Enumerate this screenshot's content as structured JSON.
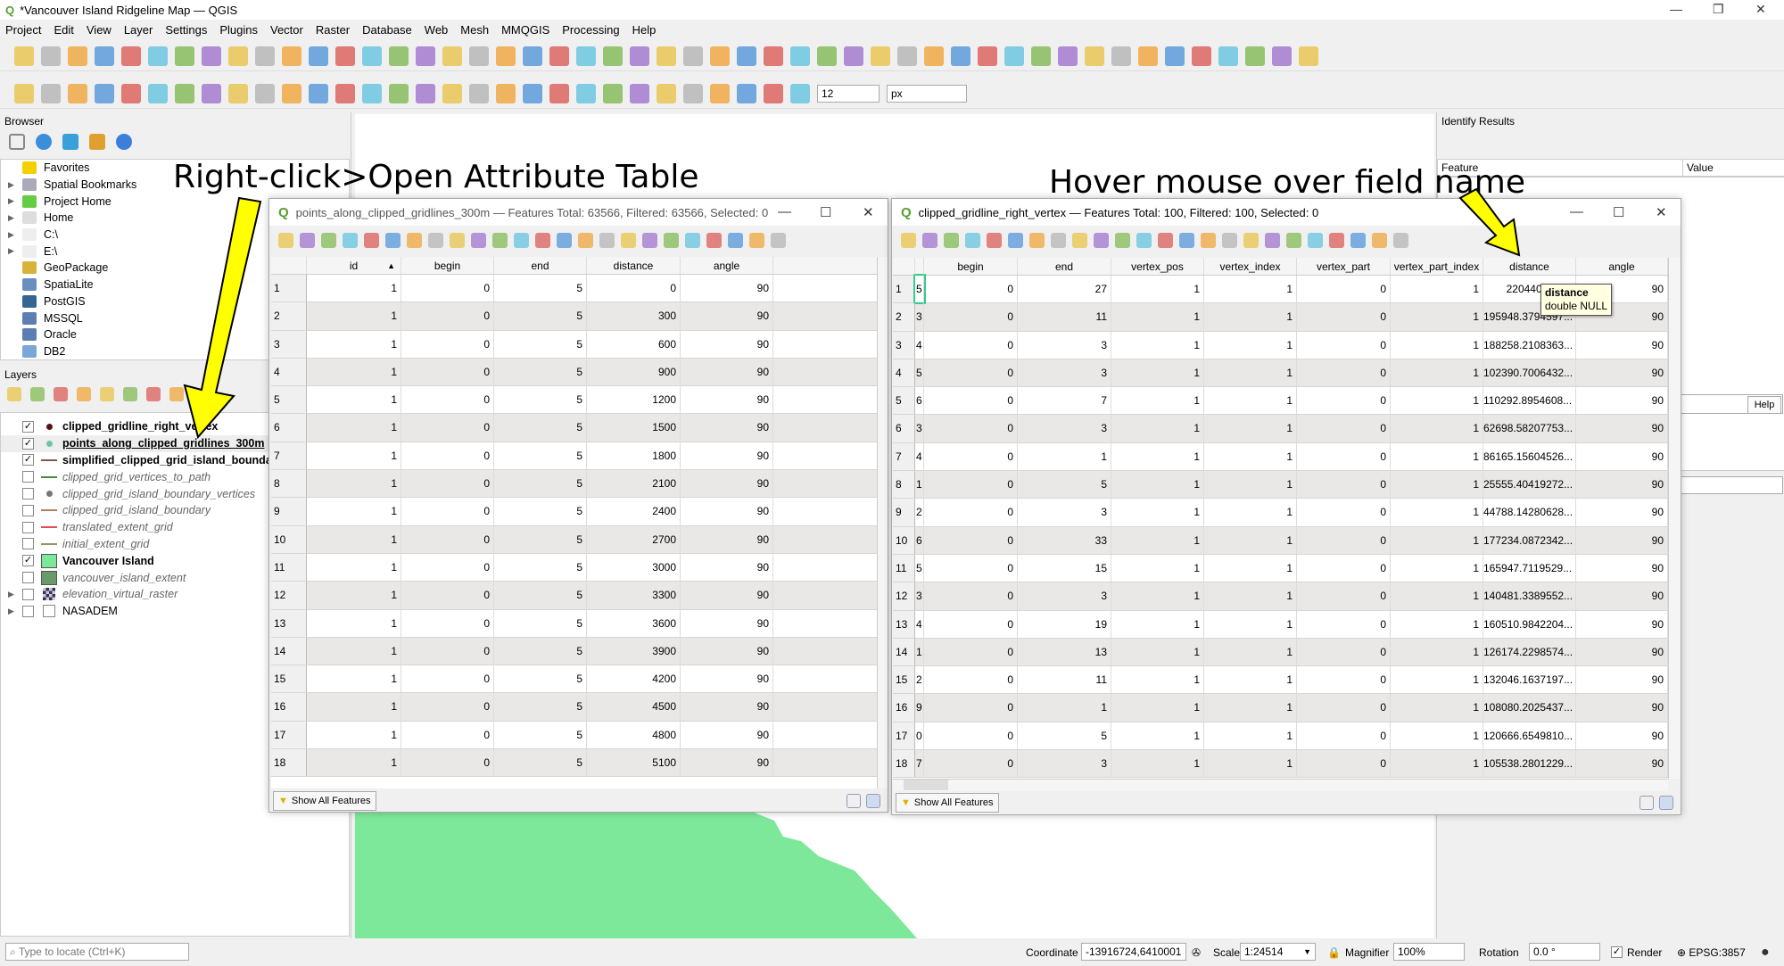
{
  "app": {
    "title": "*Vancouver Island Ridgeline Map — QGIS"
  },
  "menu": [
    "Project",
    "Edit",
    "View",
    "Layer",
    "Settings",
    "Plugins",
    "Vector",
    "Raster",
    "Database",
    "Web",
    "Mesh",
    "MMQGIS",
    "Processing",
    "Help"
  ],
  "toolbar1_icons": [
    "new-project",
    "open-project",
    "save-project",
    "save-as",
    "print-layout",
    "style-manager",
    "pan",
    "pan-to-selection",
    "zoom-in",
    "zoom-out",
    "zoom-full",
    "zoom-selection",
    "zoom-layer",
    "zoom-native",
    "zoom-last",
    "zoom-next",
    "new-map-view",
    "new-3d-view",
    "new-bookmark",
    "show-bookmarks",
    "temporal-controller",
    "refresh",
    "identify",
    "open-attribute-table",
    "toggle-processing",
    "statistics",
    "measure",
    "map-tips",
    "select-location",
    "text-annotation",
    "wms",
    "wfs",
    "metasearch",
    "python-console",
    "plugin-a",
    "prev-inter",
    "prev-clip",
    "multi",
    "paste",
    "plugin-b",
    "plugin-c",
    "label-tool",
    "label-pin",
    "label-show",
    "label-remove",
    "label-rotate",
    "label-change",
    "label-move",
    "label-props"
  ],
  "toolbar2_icons": [
    "digitize",
    "toggle-editing",
    "save-edits",
    "add-feature",
    "vertex-tool",
    "delete-selected",
    "cut",
    "copy",
    "paste",
    "undo",
    "redo",
    "add-polygon",
    "add-ring",
    "add-part",
    "fill-ring",
    "reshape",
    "offset-curve",
    "split-features",
    "merge",
    "rotate",
    "simplify",
    "select-features",
    "select-value",
    "deselect",
    "select-all",
    "rotate-point",
    "snapping",
    "trace",
    "tolerance-units",
    "digitize-line"
  ],
  "toolbar2": {
    "tolerance": "12",
    "units": "px"
  },
  "browser": {
    "title": "Browser",
    "items": [
      {
        "label": "Favorites",
        "icon": "star-icon",
        "expandable": false,
        "color": "#f5d000"
      },
      {
        "label": "Spatial Bookmarks",
        "icon": "bookmark-icon",
        "expandable": true,
        "color": "#aab"
      },
      {
        "label": "Project Home",
        "icon": "project-home-icon",
        "expandable": true,
        "color": "#6c4"
      },
      {
        "label": "Home",
        "icon": "home-icon",
        "expandable": true,
        "color": "#ddd"
      },
      {
        "label": "C:\\",
        "icon": "folder-icon",
        "expandable": true,
        "color": "#eee"
      },
      {
        "label": "E:\\",
        "icon": "folder-icon",
        "expandable": true,
        "color": "#eee"
      },
      {
        "label": "GeoPackage",
        "icon": "geopackage-icon",
        "expandable": false,
        "color": "#d9b23c"
      },
      {
        "label": "SpatiaLite",
        "icon": "spatialite-icon",
        "expandable": false,
        "color": "#6a8fbf"
      },
      {
        "label": "PostGIS",
        "icon": "postgis-icon",
        "expandable": false,
        "color": "#336791"
      },
      {
        "label": "MSSQL",
        "icon": "mssql-icon",
        "expandable": false,
        "color": "#5b7fb3"
      },
      {
        "label": "Oracle",
        "icon": "oracle-icon",
        "expandable": false,
        "color": "#5b7fb3"
      },
      {
        "label": "DB2",
        "icon": "db2-icon",
        "expandable": false,
        "color": "#7aa6d8"
      }
    ]
  },
  "layers": {
    "title": "Layers",
    "items": [
      {
        "label": "clipped_gridline_right_vertex",
        "checked": true,
        "visible_style": "on",
        "symbol": "point",
        "color": "#5a1010"
      },
      {
        "label": "points_along_clipped_gridlines_300m",
        "checked": true,
        "visible_style": "on",
        "symbol": "point",
        "color": "#6cc7a0",
        "selected": true
      },
      {
        "label": "simplified_clipped_grid_island_boundary",
        "checked": true,
        "visible_style": "on",
        "symbol": "line",
        "color": "#7a5a4a"
      },
      {
        "label": "clipped_grid_vertices_to_path",
        "checked": false,
        "visible_style": "off",
        "symbol": "line",
        "color": "#4a8a3a"
      },
      {
        "label": "clipped_grid_island_boundary_vertices",
        "checked": false,
        "visible_style": "off",
        "symbol": "point",
        "color": "#777"
      },
      {
        "label": "clipped_grid_island_boundary",
        "checked": false,
        "visible_style": "off",
        "symbol": "line",
        "color": "#b08060"
      },
      {
        "label": "translated_extent_grid",
        "checked": false,
        "visible_style": "off",
        "symbol": "line",
        "color": "#e05050"
      },
      {
        "label": "initial_extent_grid",
        "checked": false,
        "visible_style": "off",
        "symbol": "line",
        "color": "#a09060"
      },
      {
        "label": "Vancouver Island",
        "checked": true,
        "visible_style": "on",
        "symbol": "fill",
        "color": "#7ee89a"
      },
      {
        "label": "vancouver_island_extent",
        "checked": false,
        "visible_style": "off",
        "symbol": "fill",
        "color": "#6a9a6a"
      },
      {
        "label": "elevation_virtual_raster",
        "checked": false,
        "visible_style": "off",
        "symbol": "raster",
        "color": "#335",
        "expandable": true
      },
      {
        "label": "NASADEM",
        "checked": false,
        "visible_style": "plain",
        "symbol": "group",
        "color": "#888",
        "expandable": true
      }
    ]
  },
  "identify": {
    "title": "Identify Results",
    "col_feature": "Feature",
    "col_value": "Value",
    "help": "Help"
  },
  "left_table": {
    "title": "points_along_clipped_gridlines_300m — Features Total: 63566, Filtered: 63566, Selected: 0",
    "columns": [
      "id",
      "begin",
      "end",
      "distance",
      "angle"
    ],
    "sort_indicator": "▲",
    "rows": [
      [
        "1",
        "1",
        "0",
        "5",
        "0",
        "90"
      ],
      [
        "2",
        "1",
        "0",
        "5",
        "300",
        "90"
      ],
      [
        "3",
        "1",
        "0",
        "5",
        "600",
        "90"
      ],
      [
        "4",
        "1",
        "0",
        "5",
        "900",
        "90"
      ],
      [
        "5",
        "1",
        "0",
        "5",
        "1200",
        "90"
      ],
      [
        "6",
        "1",
        "0",
        "5",
        "1500",
        "90"
      ],
      [
        "7",
        "1",
        "0",
        "5",
        "1800",
        "90"
      ],
      [
        "8",
        "1",
        "0",
        "5",
        "2100",
        "90"
      ],
      [
        "9",
        "1",
        "0",
        "5",
        "2400",
        "90"
      ],
      [
        "10",
        "1",
        "0",
        "5",
        "2700",
        "90"
      ],
      [
        "11",
        "1",
        "0",
        "5",
        "3000",
        "90"
      ],
      [
        "12",
        "1",
        "0",
        "5",
        "3300",
        "90"
      ],
      [
        "13",
        "1",
        "0",
        "5",
        "3600",
        "90"
      ],
      [
        "14",
        "1",
        "0",
        "5",
        "3900",
        "90"
      ],
      [
        "15",
        "1",
        "0",
        "5",
        "4200",
        "90"
      ],
      [
        "16",
        "1",
        "0",
        "5",
        "4500",
        "90"
      ],
      [
        "17",
        "1",
        "0",
        "5",
        "4800",
        "90"
      ],
      [
        "18",
        "1",
        "0",
        "5",
        "5100",
        "90"
      ]
    ],
    "show_all": "Show All Features"
  },
  "right_table": {
    "title": "clipped_gridline_right_vertex — Features Total: 100, Filtered: 100, Selected: 0",
    "columns": [
      "",
      "begin",
      "end",
      "vertex_pos",
      "vertex_index",
      "vertex_part",
      "vertex_part_index",
      "distance",
      "angle"
    ],
    "rows": [
      [
        "1",
        "5",
        "0",
        "27",
        "1",
        "1",
        "0",
        "1",
        "220440.805...",
        "90"
      ],
      [
        "2",
        "3",
        "0",
        "11",
        "1",
        "1",
        "0",
        "1",
        "195948.3794597...",
        "90"
      ],
      [
        "3",
        "4",
        "0",
        "3",
        "1",
        "1",
        "0",
        "1",
        "188258.2108363...",
        "90"
      ],
      [
        "4",
        "5",
        "0",
        "3",
        "1",
        "1",
        "0",
        "1",
        "102390.7006432...",
        "90"
      ],
      [
        "5",
        "6",
        "0",
        "7",
        "1",
        "1",
        "0",
        "1",
        "110292.8954608...",
        "90"
      ],
      [
        "6",
        "3",
        "0",
        "3",
        "1",
        "1",
        "0",
        "1",
        "62698.58207753...",
        "90"
      ],
      [
        "7",
        "4",
        "0",
        "1",
        "1",
        "1",
        "0",
        "1",
        "86165.15604526...",
        "90"
      ],
      [
        "8",
        "1",
        "0",
        "5",
        "1",
        "1",
        "0",
        "1",
        "25555.40419272...",
        "90"
      ],
      [
        "9",
        "2",
        "0",
        "3",
        "1",
        "1",
        "0",
        "1",
        "44788.14280628...",
        "90"
      ],
      [
        "10",
        "6",
        "0",
        "33",
        "1",
        "1",
        "0",
        "1",
        "177234.0872342...",
        "90"
      ],
      [
        "11",
        "5",
        "0",
        "15",
        "1",
        "1",
        "0",
        "1",
        "165947.7119529...",
        "90"
      ],
      [
        "12",
        "3",
        "0",
        "3",
        "1",
        "1",
        "0",
        "1",
        "140481.3389552...",
        "90"
      ],
      [
        "13",
        "4",
        "0",
        "19",
        "1",
        "1",
        "0",
        "1",
        "160510.9842204...",
        "90"
      ],
      [
        "14",
        "1",
        "0",
        "13",
        "1",
        "1",
        "0",
        "1",
        "126174.2298574...",
        "90"
      ],
      [
        "15",
        "2",
        "0",
        "11",
        "1",
        "1",
        "0",
        "1",
        "132046.1637197...",
        "90"
      ],
      [
        "16",
        "9",
        "0",
        "1",
        "1",
        "1",
        "0",
        "1",
        "108080.2025437...",
        "90"
      ],
      [
        "17",
        "0",
        "0",
        "5",
        "1",
        "1",
        "0",
        "1",
        "120666.6549810...",
        "90"
      ],
      [
        "18",
        "7",
        "0",
        "3",
        "1",
        "1",
        "0",
        "1",
        "105538.2801229...",
        "90"
      ]
    ],
    "tooltip": {
      "name": "distance",
      "type": "double NULL"
    },
    "show_all": "Show All Features"
  },
  "table_tool_icons": [
    "toggle-editing",
    "multi-edit",
    "save-edits",
    "reload",
    "add-feature",
    "delete-feature",
    "cut",
    "copy",
    "paste",
    "expression-select",
    "select-all",
    "invert-selection",
    "deselect",
    "filter-selected",
    "move-selection-top",
    "pan-to-selected",
    "zoom-to-selected",
    "new-field",
    "delete-field",
    "field-calculator",
    "conditional-formatting",
    "actions",
    "dock",
    "zoom-table"
  ],
  "annotations": {
    "left": "Right-click>Open Attribute Table",
    "right": "Hover mouse over field name",
    "arrow_color": "#ffff00"
  },
  "statusbar": {
    "locate_placeholder": "Type to locate (Ctrl+K)",
    "coordinate_label": "Coordinate",
    "coordinate": "-13916724,6410001",
    "scale_label": "Scale",
    "scale": "1:24514",
    "magnifier_label": "Magnifier",
    "magnifier": "100%",
    "rotation_label": "Rotation",
    "rotation": "0.0 °",
    "render_label": "Render",
    "render_checked": true,
    "crs": "EPSG:3857"
  },
  "colors": {
    "island_fill": "#7ee89a",
    "grid_alt_row": "#e9e8e6"
  }
}
